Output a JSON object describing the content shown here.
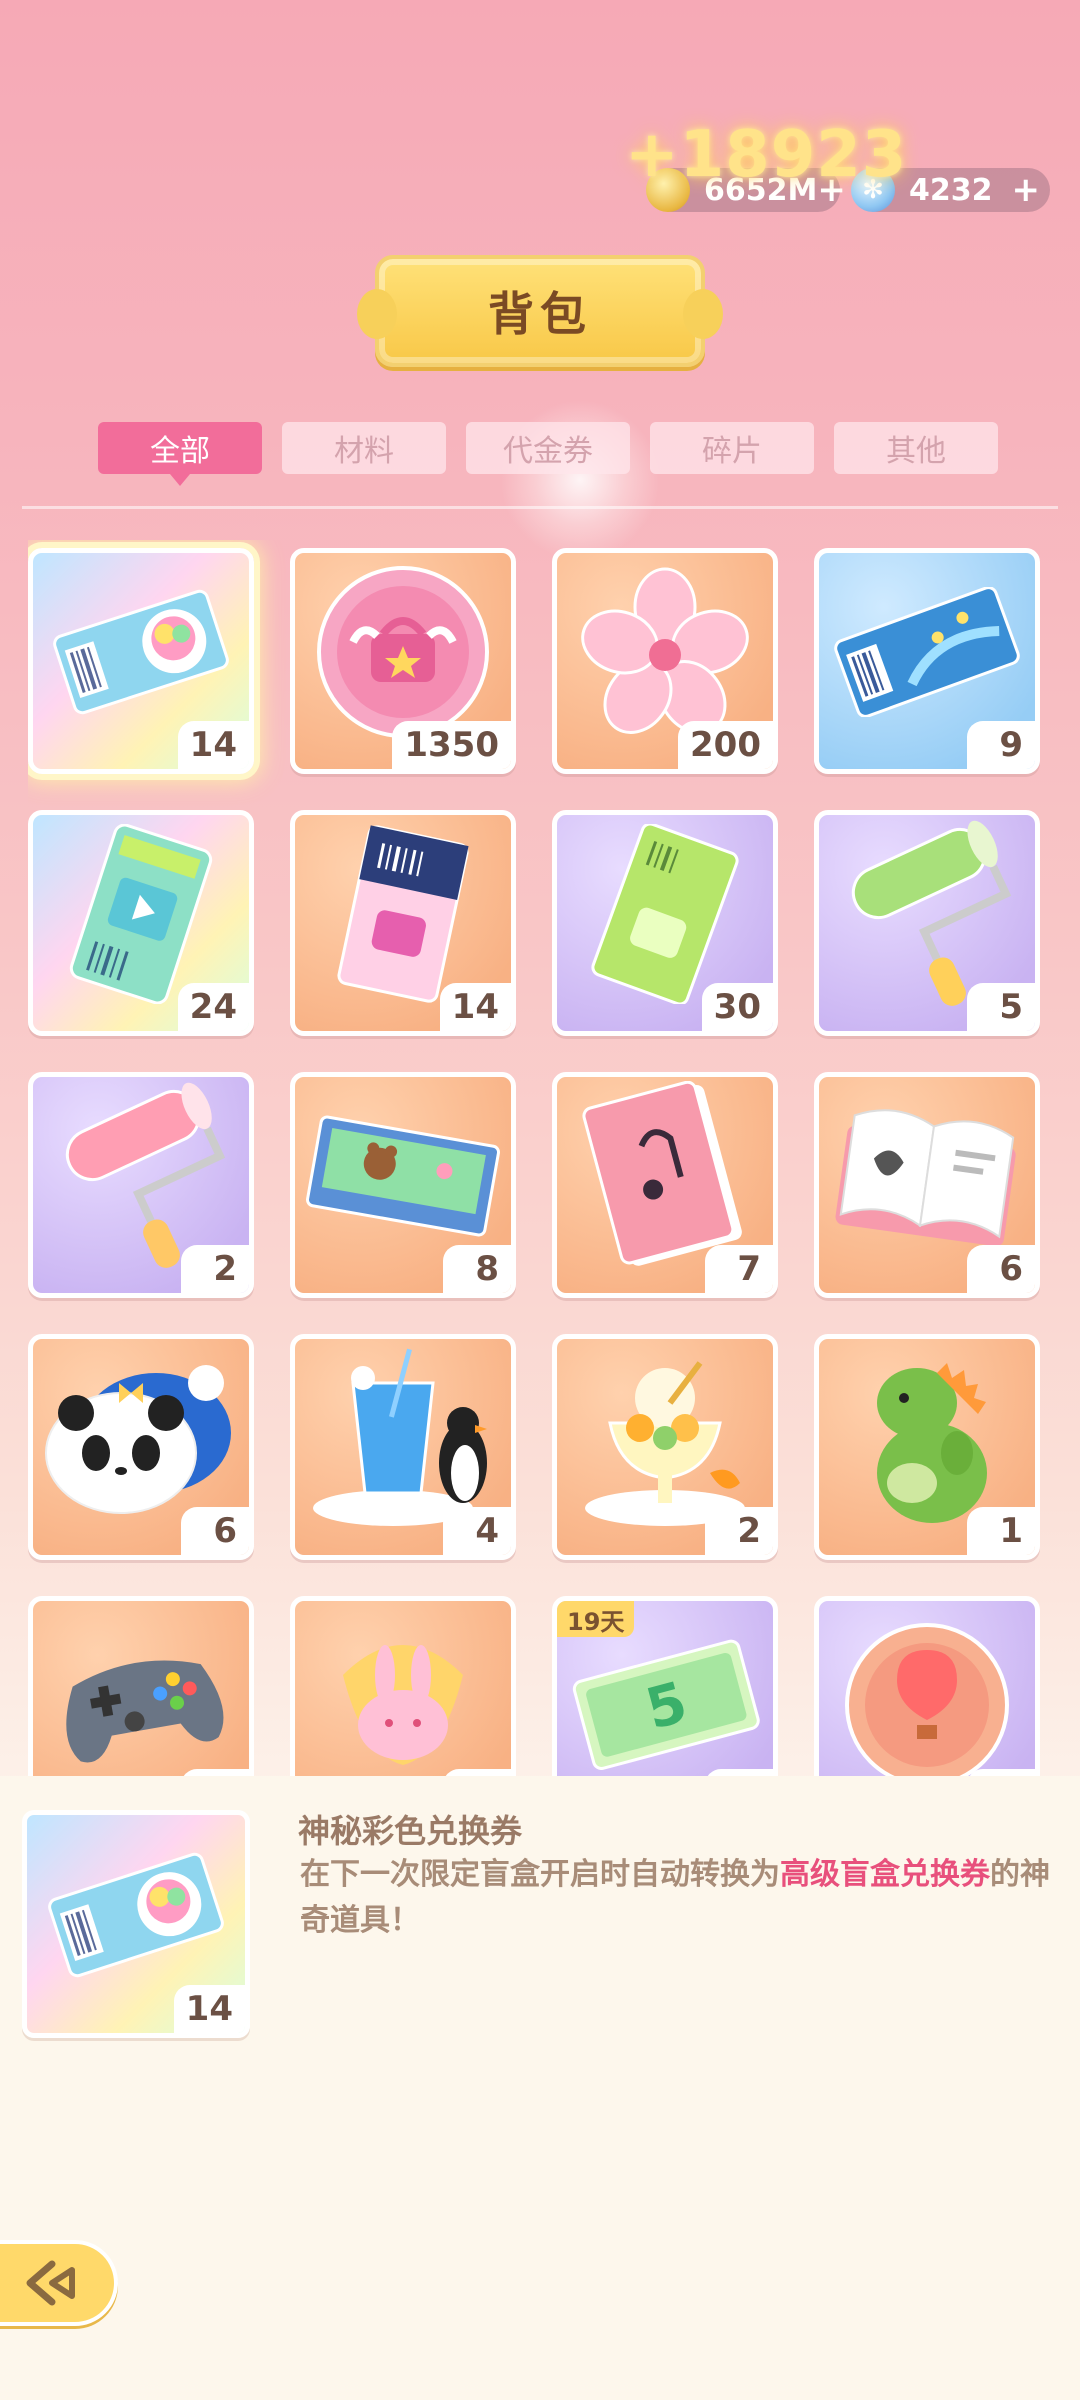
{
  "header": {
    "floating_gain": "+18923",
    "gold_amount": "6652M",
    "gem_amount": "4232",
    "plus_symbol": "+",
    "title": "背包"
  },
  "tabs": [
    {
      "label": "全部",
      "active": true
    },
    {
      "label": "材料",
      "active": false
    },
    {
      "label": "代金券",
      "active": false
    },
    {
      "label": "碎片",
      "active": false
    },
    {
      "label": "其他",
      "active": false
    }
  ],
  "items": [
    {
      "name": "rainbow-ticket",
      "count": "14",
      "bg": "rainbow",
      "selected": true
    },
    {
      "name": "pink-badge-coin",
      "count": "1350",
      "bg": "orange"
    },
    {
      "name": "sakura-flower",
      "count": "200",
      "bg": "orange"
    },
    {
      "name": "blue-ticket",
      "count": "9",
      "bg": "blue"
    },
    {
      "name": "video-ticket",
      "count": "24",
      "bg": "rainbow"
    },
    {
      "name": "dark-ticket",
      "count": "14",
      "bg": "orange"
    },
    {
      "name": "green-ticket",
      "count": "30",
      "bg": "purple"
    },
    {
      "name": "green-paint-roller",
      "count": "5",
      "bg": "purple"
    },
    {
      "name": "pink-paint-roller",
      "count": "2",
      "bg": "purple"
    },
    {
      "name": "puzzle-box",
      "count": "8",
      "bg": "orange"
    },
    {
      "name": "music-book",
      "count": "7",
      "bg": "orange"
    },
    {
      "name": "coloring-book",
      "count": "6",
      "bg": "orange"
    },
    {
      "name": "panda-cushion",
      "count": "6",
      "bg": "orange"
    },
    {
      "name": "blue-drink-penguin",
      "count": "4",
      "bg": "orange"
    },
    {
      "name": "fruit-parfait",
      "count": "2",
      "bg": "orange"
    },
    {
      "name": "green-dinosaur",
      "count": "1",
      "bg": "orange"
    },
    {
      "name": "game-controller",
      "count": "",
      "bg": "orange"
    },
    {
      "name": "bunny-candy",
      "count": "",
      "bg": "orange"
    },
    {
      "name": "sale-coupon",
      "count": "",
      "bg": "purple",
      "badge": "19天"
    },
    {
      "name": "balloon-medal",
      "count": "",
      "bg": "purple"
    }
  ],
  "detail": {
    "count": "14",
    "name": "神秘彩色兑换券",
    "desc_before": "在下一次限定盲盒开启时自动转换为",
    "desc_highlight": "高级盲盒兑换券",
    "desc_after": "的神奇道具！"
  },
  "colors": {
    "accent_pink": "#f26d9a",
    "highlight": "#e8507c",
    "gold": "#ffd96a"
  }
}
